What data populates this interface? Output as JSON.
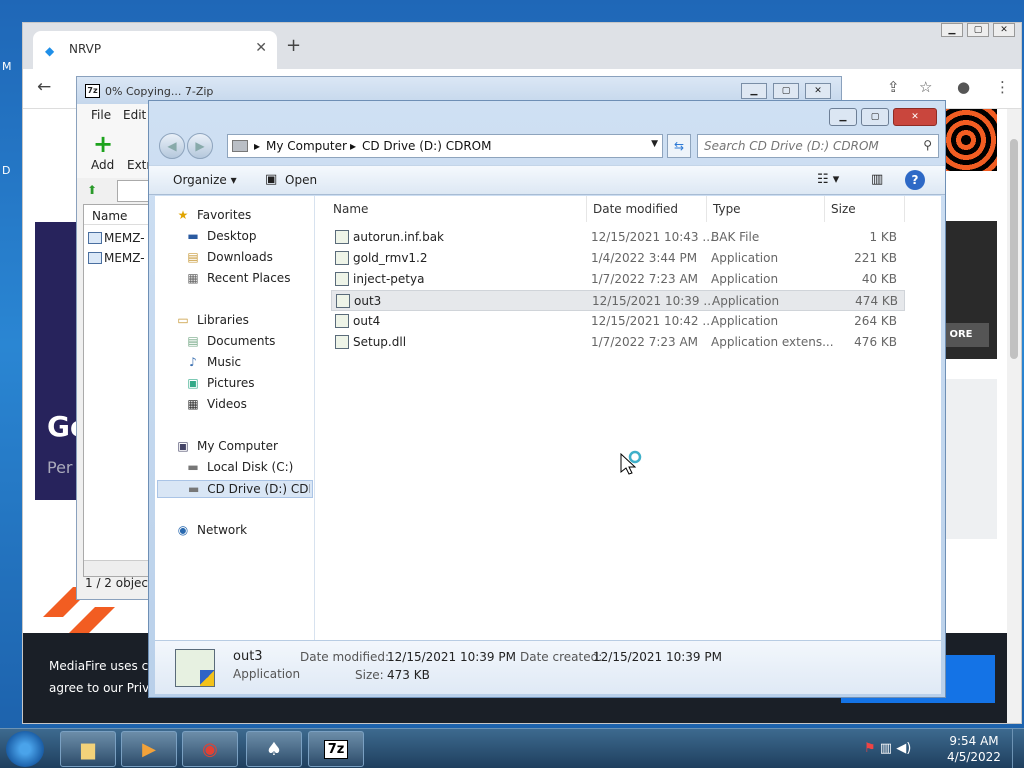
{
  "desktop": {
    "left_letters": [
      "M",
      "D"
    ]
  },
  "chrome": {
    "tab_title": "NRVP",
    "new_tab": "+",
    "close_tab": "✕",
    "page": {
      "hero_heading": "Ge",
      "hero_sub": "Per",
      "more_btn": "ORE",
      "banner_line1": "MediaFire uses c",
      "banner_line2": "agree to our Priv"
    }
  },
  "sevenzip": {
    "title": "0% Copying... 7-Zip",
    "menu": [
      "File",
      "Edit"
    ],
    "toolbar": {
      "add": "Add",
      "extract": "Extr"
    },
    "list_header": "Name",
    "files": [
      "MEMZ-",
      "MEMZ-"
    ],
    "status": "1 / 2 object("
  },
  "explorer": {
    "breadcrumb": [
      "My Computer",
      "CD Drive (D:) CDROM"
    ],
    "search_placeholder": "Search CD Drive (D:) CDROM",
    "command_bar": {
      "organize": "Organize",
      "open": "Open"
    },
    "nav": {
      "favorites": "Favorites",
      "favorites_items": [
        "Desktop",
        "Downloads",
        "Recent Places"
      ],
      "libraries": "Libraries",
      "libraries_items": [
        "Documents",
        "Music",
        "Pictures",
        "Videos"
      ],
      "computer": "My Computer",
      "computer_items": [
        "Local Disk (C:)",
        "CD Drive (D:) CDROM"
      ],
      "network": "Network"
    },
    "columns": [
      "Name",
      "Date modified",
      "Type",
      "Size"
    ],
    "files": [
      {
        "name": "autorun.inf.bak",
        "date": "12/15/2021 10:43 ...",
        "type": "BAK File",
        "size": "1 KB"
      },
      {
        "name": "gold_rmv1.2",
        "date": "1/4/2022 3:44 PM",
        "type": "Application",
        "size": "221 KB"
      },
      {
        "name": "inject-petya",
        "date": "1/7/2022 7:23 AM",
        "type": "Application",
        "size": "40 KB"
      },
      {
        "name": "out3",
        "date": "12/15/2021 10:39 ...",
        "type": "Application",
        "size": "474 KB"
      },
      {
        "name": "out4",
        "date": "12/15/2021 10:42 ...",
        "type": "Application",
        "size": "264 KB"
      },
      {
        "name": "Setup.dll",
        "date": "1/7/2022 7:23 AM",
        "type": "Application extens...",
        "size": "476 KB"
      }
    ],
    "details": {
      "name": "out3",
      "type": "Application",
      "date_modified_label": "Date modified:",
      "date_modified": "12/15/2021 10:39 PM",
      "date_created_label": "Date created:",
      "date_created": "12/15/2021 10:39 PM",
      "size_label": "Size:",
      "size": "473 KB"
    }
  },
  "taskbar": {
    "time": "9:54 AM",
    "date": "4/5/2022",
    "sevenzip_label": "7z"
  },
  "colors": {
    "accent": "#2e69c6",
    "selection": "#e6e8eb",
    "taskbar": "#1f3f5e"
  }
}
